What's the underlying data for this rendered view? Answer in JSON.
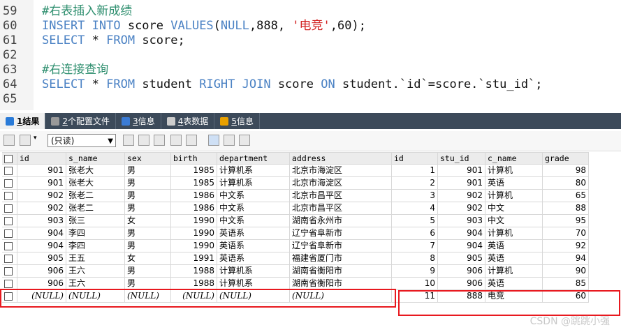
{
  "editor": {
    "lines": [
      {
        "num": "59",
        "parts": [
          {
            "t": "cm",
            "v": "#右表插入新成绩"
          }
        ]
      },
      {
        "num": "60",
        "parts": [
          {
            "t": "kw",
            "v": "INSERT INTO "
          },
          {
            "t": "tx",
            "v": "score "
          },
          {
            "t": "kw",
            "v": "VALUES"
          },
          {
            "t": "tx",
            "v": "("
          },
          {
            "t": "kw",
            "v": "NULL"
          },
          {
            "t": "tx",
            "v": ",888, "
          },
          {
            "t": "st",
            "v": "'电竞'"
          },
          {
            "t": "tx",
            "v": ",60);"
          }
        ]
      },
      {
        "num": "61",
        "parts": [
          {
            "t": "kw",
            "v": "SELECT "
          },
          {
            "t": "tx",
            "v": "* "
          },
          {
            "t": "kw",
            "v": "FROM "
          },
          {
            "t": "tx",
            "v": "score;"
          }
        ]
      },
      {
        "num": "62",
        "parts": []
      },
      {
        "num": "63",
        "parts": [
          {
            "t": "cm",
            "v": "#右连接查询"
          }
        ]
      },
      {
        "num": "64",
        "parts": [
          {
            "t": "kw",
            "v": "SELECT "
          },
          {
            "t": "tx",
            "v": "* "
          },
          {
            "t": "kw",
            "v": "FROM "
          },
          {
            "t": "tx",
            "v": "student "
          },
          {
            "t": "kw",
            "v": "RIGHT JOIN "
          },
          {
            "t": "tx",
            "v": "score "
          },
          {
            "t": "kw",
            "v": "ON "
          },
          {
            "t": "tx",
            "v": "student.`id`=score.`stu_id`;"
          }
        ]
      },
      {
        "num": "65",
        "parts": []
      }
    ]
  },
  "tabs": [
    {
      "key": "1",
      "label": "结果",
      "active": true,
      "color": "#2a7bd8"
    },
    {
      "key": "2",
      "label": "个配置文件",
      "active": false,
      "color": "#999999"
    },
    {
      "key": "3",
      "label": "信息",
      "active": false,
      "color": "#3a7bd5"
    },
    {
      "key": "4",
      "label": "表数据",
      "active": false,
      "color": "#cccccc"
    },
    {
      "key": "5",
      "label": "信息",
      "active": false,
      "color": "#e8a000"
    }
  ],
  "toolbar": {
    "readonly_label": "(只读)"
  },
  "grid": {
    "columns": [
      "id",
      "s_name",
      "sex",
      "birth",
      "department",
      "address",
      "id",
      "stu_id",
      "c_name",
      "grade"
    ],
    "rows": [
      [
        "901",
        "张老大",
        "男",
        "1985",
        "计算机系",
        "北京市海淀区",
        "1",
        "901",
        "计算机",
        "98"
      ],
      [
        "901",
        "张老大",
        "男",
        "1985",
        "计算机系",
        "北京市海淀区",
        "2",
        "901",
        "英语",
        "80"
      ],
      [
        "902",
        "张老二",
        "男",
        "1986",
        "中文系",
        "北京市昌平区",
        "3",
        "902",
        "计算机",
        "65"
      ],
      [
        "902",
        "张老二",
        "男",
        "1986",
        "中文系",
        "北京市昌平区",
        "4",
        "902",
        "中文",
        "88"
      ],
      [
        "903",
        "张三",
        "女",
        "1990",
        "中文系",
        "湖南省永州市",
        "5",
        "903",
        "中文",
        "95"
      ],
      [
        "904",
        "李四",
        "男",
        "1990",
        "英语系",
        "辽宁省阜新市",
        "6",
        "904",
        "计算机",
        "70"
      ],
      [
        "904",
        "李四",
        "男",
        "1990",
        "英语系",
        "辽宁省阜新市",
        "7",
        "904",
        "英语",
        "92"
      ],
      [
        "905",
        "王五",
        "女",
        "1991",
        "英语系",
        "福建省厦门市",
        "8",
        "905",
        "英语",
        "94"
      ],
      [
        "906",
        "王六",
        "男",
        "1988",
        "计算机系",
        "湖南省衡阳市",
        "9",
        "906",
        "计算机",
        "90"
      ],
      [
        "906",
        "王六",
        "男",
        "1988",
        "计算机系",
        "湖南省衡阳市",
        "10",
        "906",
        "英语",
        "85"
      ],
      [
        "(NULL)",
        "(NULL)",
        "(NULL)",
        "(NULL)",
        "(NULL)",
        "(NULL)",
        "11",
        "888",
        "电竞",
        "60"
      ]
    ]
  },
  "watermark": "CSDN @跳跳小强",
  "colors": {
    "highlight_box": "#e8191f",
    "tab_bar": "#3c4a5a"
  }
}
